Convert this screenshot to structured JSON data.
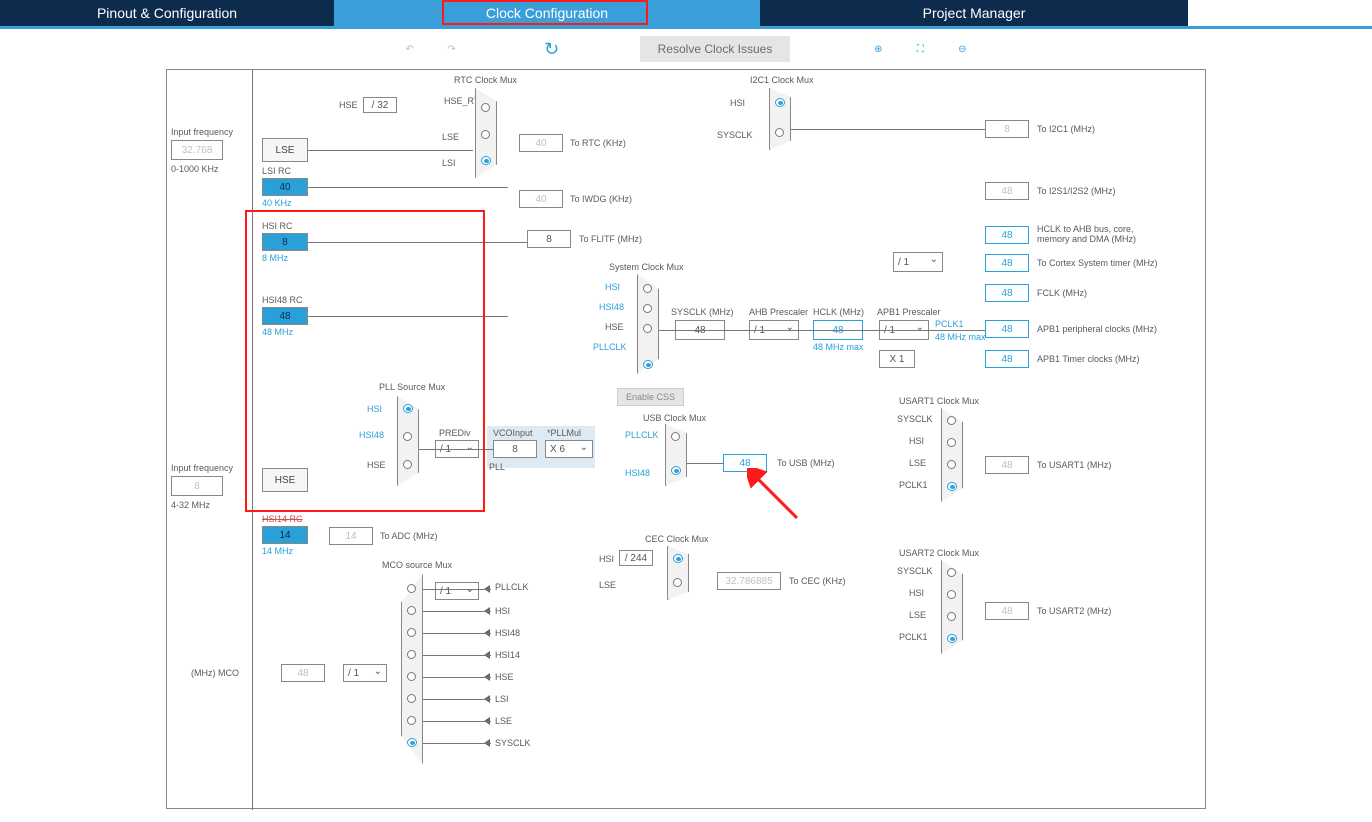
{
  "tabs": {
    "pinout": "Pinout & Configuration",
    "clock": "Clock Configuration",
    "project": "Project Manager"
  },
  "toolbar": {
    "resolve": "Resolve Clock Issues"
  },
  "input_lse": {
    "label": "Input frequency",
    "value": "32.768",
    "range": "0-1000 KHz"
  },
  "input_hse": {
    "label": "Input frequency",
    "value": "8",
    "range": "4-32 MHz"
  },
  "sources": {
    "lse": "LSE",
    "lsirc": "LSI RC",
    "lsirc_val": "40",
    "lsirc_sub": "40 KHz",
    "hsirc": "HSI RC",
    "hsirc_val": "8",
    "hsirc_sub": "8 MHz",
    "hsi48rc": "HSI48 RC",
    "hsi48rc_val": "48",
    "hsi48rc_sub": "48 MHz",
    "hse": "HSE",
    "hsi14rc": "HSI14 RC",
    "hsi14rc_val": "14",
    "hsi14rc_sub": "14 MHz"
  },
  "rtc": {
    "title": "RTC Clock Mux",
    "hse": "HSE",
    "div": "/ 32",
    "hsertc": "HSE_RTC",
    "lse": "LSE",
    "lsi": "LSI",
    "val": "40",
    "out": "To RTC (KHz)"
  },
  "iwdg": {
    "val": "40",
    "out": "To IWDG (KHz)"
  },
  "flitf": {
    "val": "8",
    "out": "To FLITF (MHz)"
  },
  "pll": {
    "title": "PLL Source Mux",
    "hsi": "HSI",
    "hsi48": "HSI48",
    "hse": "HSE",
    "prediv_lbl": "PREDiv",
    "prediv": "/ 1",
    "vcoin_lbl": "VCOInput",
    "vcoin": "8",
    "mul_lbl": "*PLLMul",
    "mul": "X 6",
    "pll_lbl": "PLL"
  },
  "sysmux": {
    "title": "System Clock Mux",
    "hsi": "HSI",
    "hsi48": "HSI48",
    "hse": "HSE",
    "pllclk": "PLLCLK"
  },
  "sysclk_lbl": "SYSCLK (MHz)",
  "sysclk": "48",
  "ahb": {
    "lbl": "AHB Prescaler",
    "val": "/ 1"
  },
  "hclk_lbl": "HCLK (MHz)",
  "hclk": "48",
  "hclk_max": "48 MHz max",
  "apb1": {
    "lbl": "APB1 Prescaler",
    "val": "/ 1",
    "pclk1_lbl": "PCLK1",
    "pclk1_max": "48 MHz max"
  },
  "cortexdiv": "/ 1",
  "x1": "X 1",
  "outputs": {
    "hclk_bus": {
      "val": "48",
      "lbl": "HCLK to AHB bus, core, memory and DMA (MHz)"
    },
    "cortex": {
      "val": "48",
      "lbl": "To Cortex System timer (MHz)"
    },
    "fclk": {
      "val": "48",
      "lbl": "FCLK (MHz)"
    },
    "apb1_per": {
      "val": "48",
      "lbl": "APB1 peripheral clocks (MHz)"
    },
    "apb1_tim": {
      "val": "48",
      "lbl": "APB1 Timer clocks (MHz)"
    }
  },
  "enable_css": "Enable CSS",
  "usb": {
    "title": "USB Clock Mux",
    "pllclk": "PLLCLK",
    "hsi48": "HSI48",
    "val": "48",
    "out": "To USB (MHz)"
  },
  "i2c1": {
    "title": "I2C1 Clock Mux",
    "hsi": "HSI",
    "sysclk": "SYSCLK",
    "val": "8",
    "out": "To I2C1 (MHz)"
  },
  "i2s": {
    "val": "48",
    "out": "To I2S1/I2S2 (MHz)"
  },
  "adc": {
    "val": "14",
    "out": "To ADC (MHz)"
  },
  "cec": {
    "title": "CEC Clock Mux",
    "hsi": "HSI",
    "div": "/ 244",
    "lse": "LSE",
    "val": "32.786885",
    "out": "To CEC (KHz)"
  },
  "usart1": {
    "title": "USART1 Clock Mux",
    "sysclk": "SYSCLK",
    "hsi": "HSI",
    "lse": "LSE",
    "pclk1": "PCLK1",
    "val": "48",
    "out": "To USART1 (MHz)"
  },
  "usart2": {
    "title": "USART2 Clock Mux",
    "sysclk": "SYSCLK",
    "hsi": "HSI",
    "lse": "LSE",
    "pclk1": "PCLK1",
    "val": "48",
    "out": "To USART2 (MHz)"
  },
  "mco": {
    "title": "MCO source Mux",
    "pllclk": "PLLCLK",
    "hsi": "HSI",
    "hsi48": "HSI48",
    "hsi14": "HSI14",
    "hse": "HSE",
    "lsi": "LSI",
    "lse": "LSE",
    "sysclk": "SYSCLK",
    "div_sel": "/ 1",
    "div": "/ 1",
    "val": "48",
    "out": "(MHz) MCO"
  }
}
